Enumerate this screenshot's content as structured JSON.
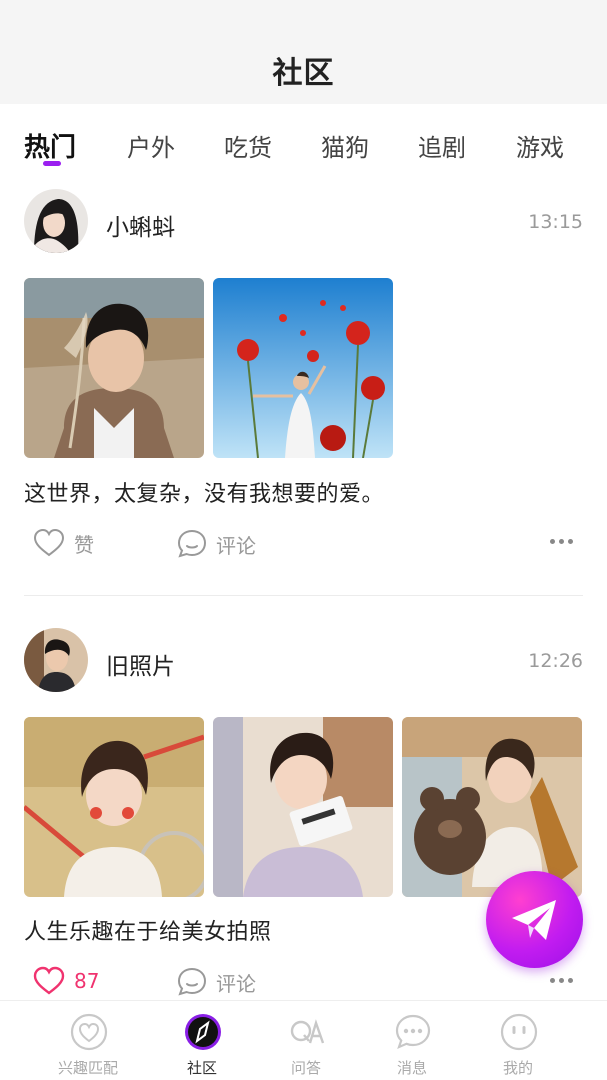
{
  "header": {
    "title": "社区"
  },
  "tabs": [
    {
      "label": "热门",
      "active": true
    },
    {
      "label": "户外",
      "active": false
    },
    {
      "label": "吃货",
      "active": false
    },
    {
      "label": "猫狗",
      "active": false
    },
    {
      "label": "追剧",
      "active": false
    },
    {
      "label": "游戏",
      "active": false
    }
  ],
  "posts": [
    {
      "username": "小蝌蚪",
      "time": "13:15",
      "caption": "这世界，太复杂，没有我想要的爱。",
      "like_label": "赞",
      "comment_label": "评论",
      "liked": false
    },
    {
      "username": "旧照片",
      "time": "12:26",
      "caption": "人生乐趣在于给美女拍照",
      "like_label": "87",
      "comment_label": "评论",
      "liked": true
    }
  ],
  "bottom_nav": [
    {
      "label": "兴趣匹配",
      "icon": "heart-bubble-icon"
    },
    {
      "label": "社区",
      "icon": "compass-icon",
      "active": true
    },
    {
      "label": "问答",
      "icon": "qa-icon"
    },
    {
      "label": "消息",
      "icon": "message-icon"
    },
    {
      "label": "我的",
      "icon": "profile-face-icon"
    }
  ],
  "colors": {
    "accent": "#9b1ff0",
    "like": "#f0336f",
    "fab": "#c21cf0"
  }
}
